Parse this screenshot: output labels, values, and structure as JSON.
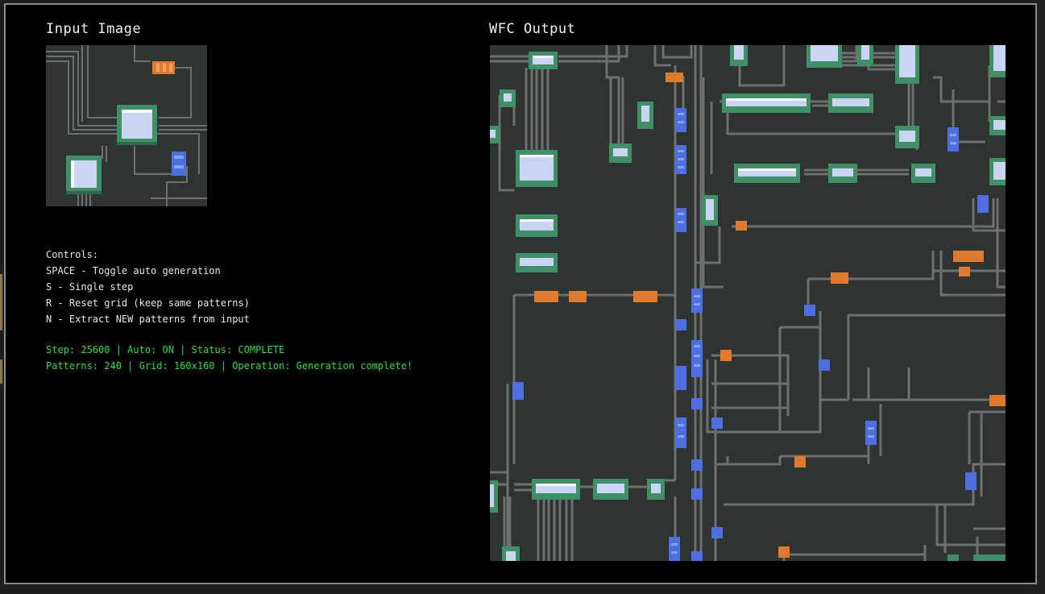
{
  "window": {
    "input_title": "Input Image",
    "output_title": "WFC Output"
  },
  "controls": {
    "heading": "Controls:",
    "items": [
      "SPACE - Toggle auto generation",
      "S - Single step",
      "R - Reset grid (keep same patterns)",
      "N - Extract NEW patterns from input"
    ]
  },
  "status": {
    "line1": "Step: 25600 | Auto: ON | Status: COMPLETE",
    "line2": "Patterns: 240 | Grid: 160x160 | Operation: Generation complete!"
  },
  "colors": {
    "board": "#2e3432",
    "wire": "#6f6f6f",
    "chip_frame": "#3f8f67",
    "chip_face": "#c9d5f2",
    "resistor": "#e07a2c",
    "capacitor": "#4f6fe0",
    "status_text": "#22e03a"
  },
  "icons": [
    "pcb-chip-icon",
    "resistor-icon",
    "capacitor-icon"
  ]
}
